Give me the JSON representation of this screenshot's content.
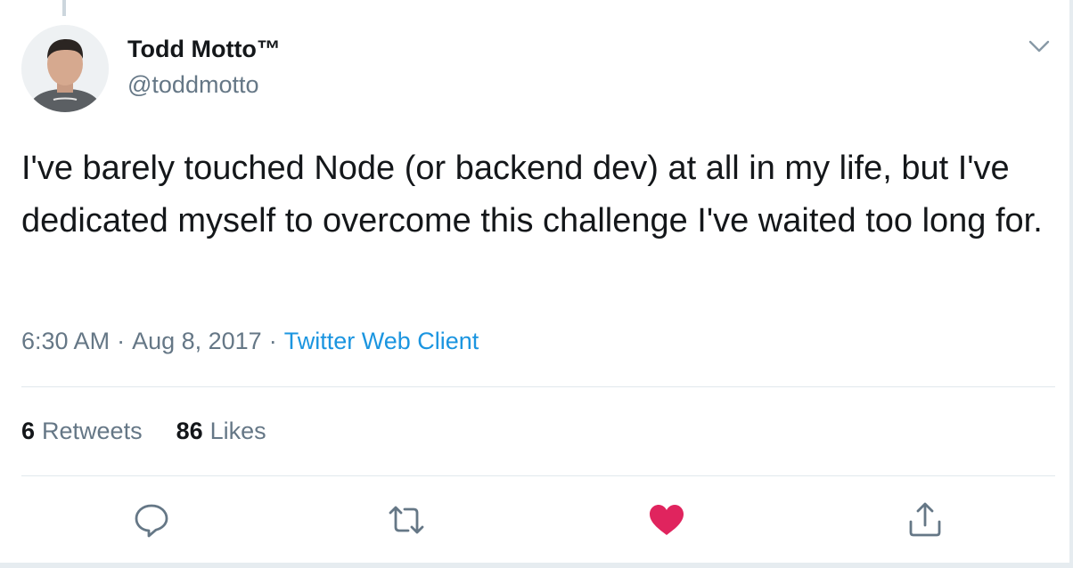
{
  "author": {
    "name": "Todd Motto™",
    "handle": "@toddmotto"
  },
  "tweet": {
    "text": "I've barely touched Node (or backend dev) at all in my life, but I've dedicated myself to overcome this challenge I've waited too long for.",
    "time": "6:30 AM",
    "date": "Aug 8, 2017",
    "source": "Twitter Web Client",
    "separator": "·"
  },
  "stats": {
    "retweets_count": "6",
    "retweets_label": "Retweets",
    "likes_count": "86",
    "likes_label": "Likes"
  },
  "actions": {
    "reply_icon": "reply-icon",
    "retweet_icon": "retweet-icon",
    "like_icon": "heart-icon",
    "like_active": true,
    "share_icon": "share-icon"
  },
  "colors": {
    "text": "#14171a",
    "muted": "#657786",
    "link": "#1b95e0",
    "liked": "#e0245e"
  }
}
